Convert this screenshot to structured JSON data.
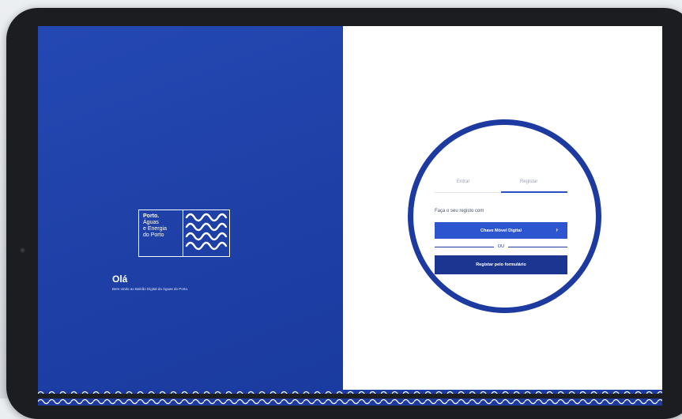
{
  "left_panel": {
    "logo": {
      "brand": "Porto.",
      "lines": [
        "Águas",
        "e Energia",
        "do Porto"
      ]
    },
    "greeting": "Olá",
    "welcome_text": "Bem-vindo ao Balcão Digital da Águas do Porto."
  },
  "right_panel": {
    "tabs": {
      "entrar": "Entrar",
      "registar": "Registar",
      "active": "Registar"
    },
    "prompt": "Faça o seu registo com",
    "cmd_button": "Chave Móvel Digital",
    "cmd_chevron": "›",
    "separator": "OU",
    "form_button": "Registar pelo formulário"
  },
  "colors": {
    "brand_blue": "#1f41a8",
    "button_blue": "#2d55cf",
    "button_dark": "#1c3590",
    "ring": "#1c3aa0"
  },
  "icons": [
    "porto-wave-logo-icon",
    "chevron-right-icon",
    "wave-pattern-icon"
  ]
}
